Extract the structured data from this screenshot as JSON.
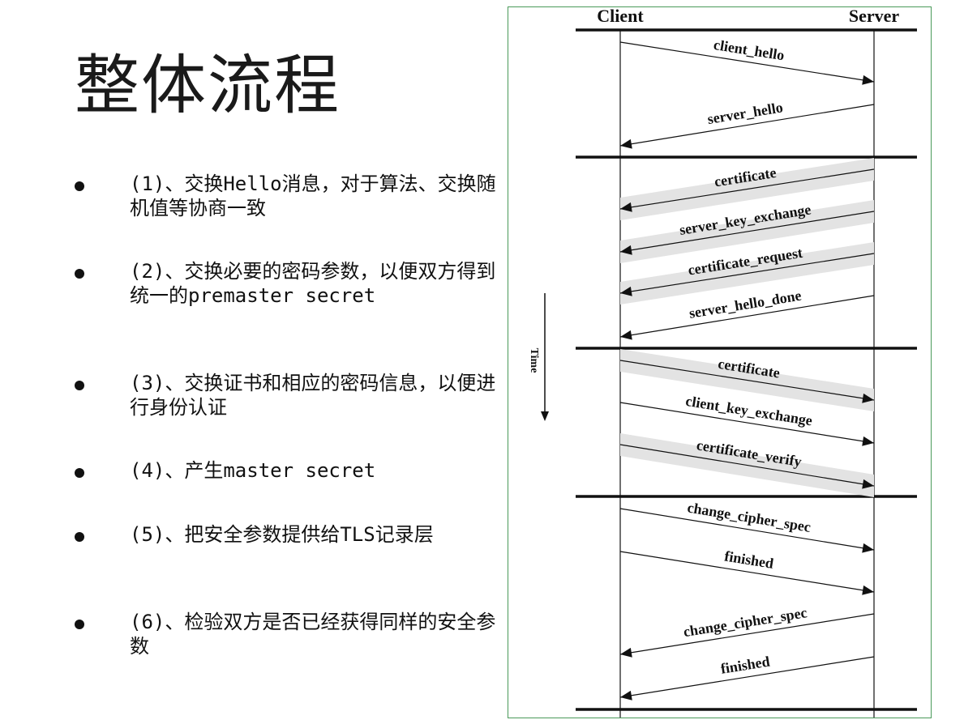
{
  "title": "整体流程",
  "bullets": [
    {
      "text": "(1)、交换Hello消息，对于算法、交换随机值等协商一致"
    },
    {
      "text": "(2)、交换必要的密码参数，以便双方得到统一的premaster secret"
    },
    {
      "text": "(3)、交换证书和相应的密码信息，以便进行身份认证"
    },
    {
      "text": "(4)、产生master secret"
    },
    {
      "text": "(5)、把安全参数提供给TLS记录层"
    },
    {
      "text": "(6)、检验双方是否已经获得同样的安全参数"
    }
  ],
  "diagram": {
    "client_label": "Client",
    "server_label": "Server",
    "time_label": "Time",
    "messages": [
      {
        "label": "client_hello",
        "dir": "c2s",
        "optional": false,
        "phase": 1
      },
      {
        "label": "server_hello",
        "dir": "s2c",
        "optional": false,
        "phase": 1
      },
      {
        "label": "certificate",
        "dir": "s2c",
        "optional": true,
        "phase": 2
      },
      {
        "label": "server_key_exchange",
        "dir": "s2c",
        "optional": true,
        "phase": 2
      },
      {
        "label": "certificate_request",
        "dir": "s2c",
        "optional": true,
        "phase": 2
      },
      {
        "label": "server_hello_done",
        "dir": "s2c",
        "optional": false,
        "phase": 2
      },
      {
        "label": "certificate",
        "dir": "c2s",
        "optional": true,
        "phase": 3
      },
      {
        "label": "client_key_exchange",
        "dir": "c2s",
        "optional": false,
        "phase": 3
      },
      {
        "label": "certificate_verify",
        "dir": "c2s",
        "optional": true,
        "phase": 3
      },
      {
        "label": "change_cipher_spec",
        "dir": "c2s",
        "optional": false,
        "phase": 4
      },
      {
        "label": "finished",
        "dir": "c2s",
        "optional": false,
        "phase": 4
      },
      {
        "label": "change_cipher_spec",
        "dir": "s2c",
        "optional": false,
        "phase": 4
      },
      {
        "label": "finished",
        "dir": "s2c",
        "optional": false,
        "phase": 4
      }
    ],
    "colors": {
      "line": "#111111",
      "shade": "#e3e3e3",
      "frame": "#4a9a5a"
    }
  }
}
